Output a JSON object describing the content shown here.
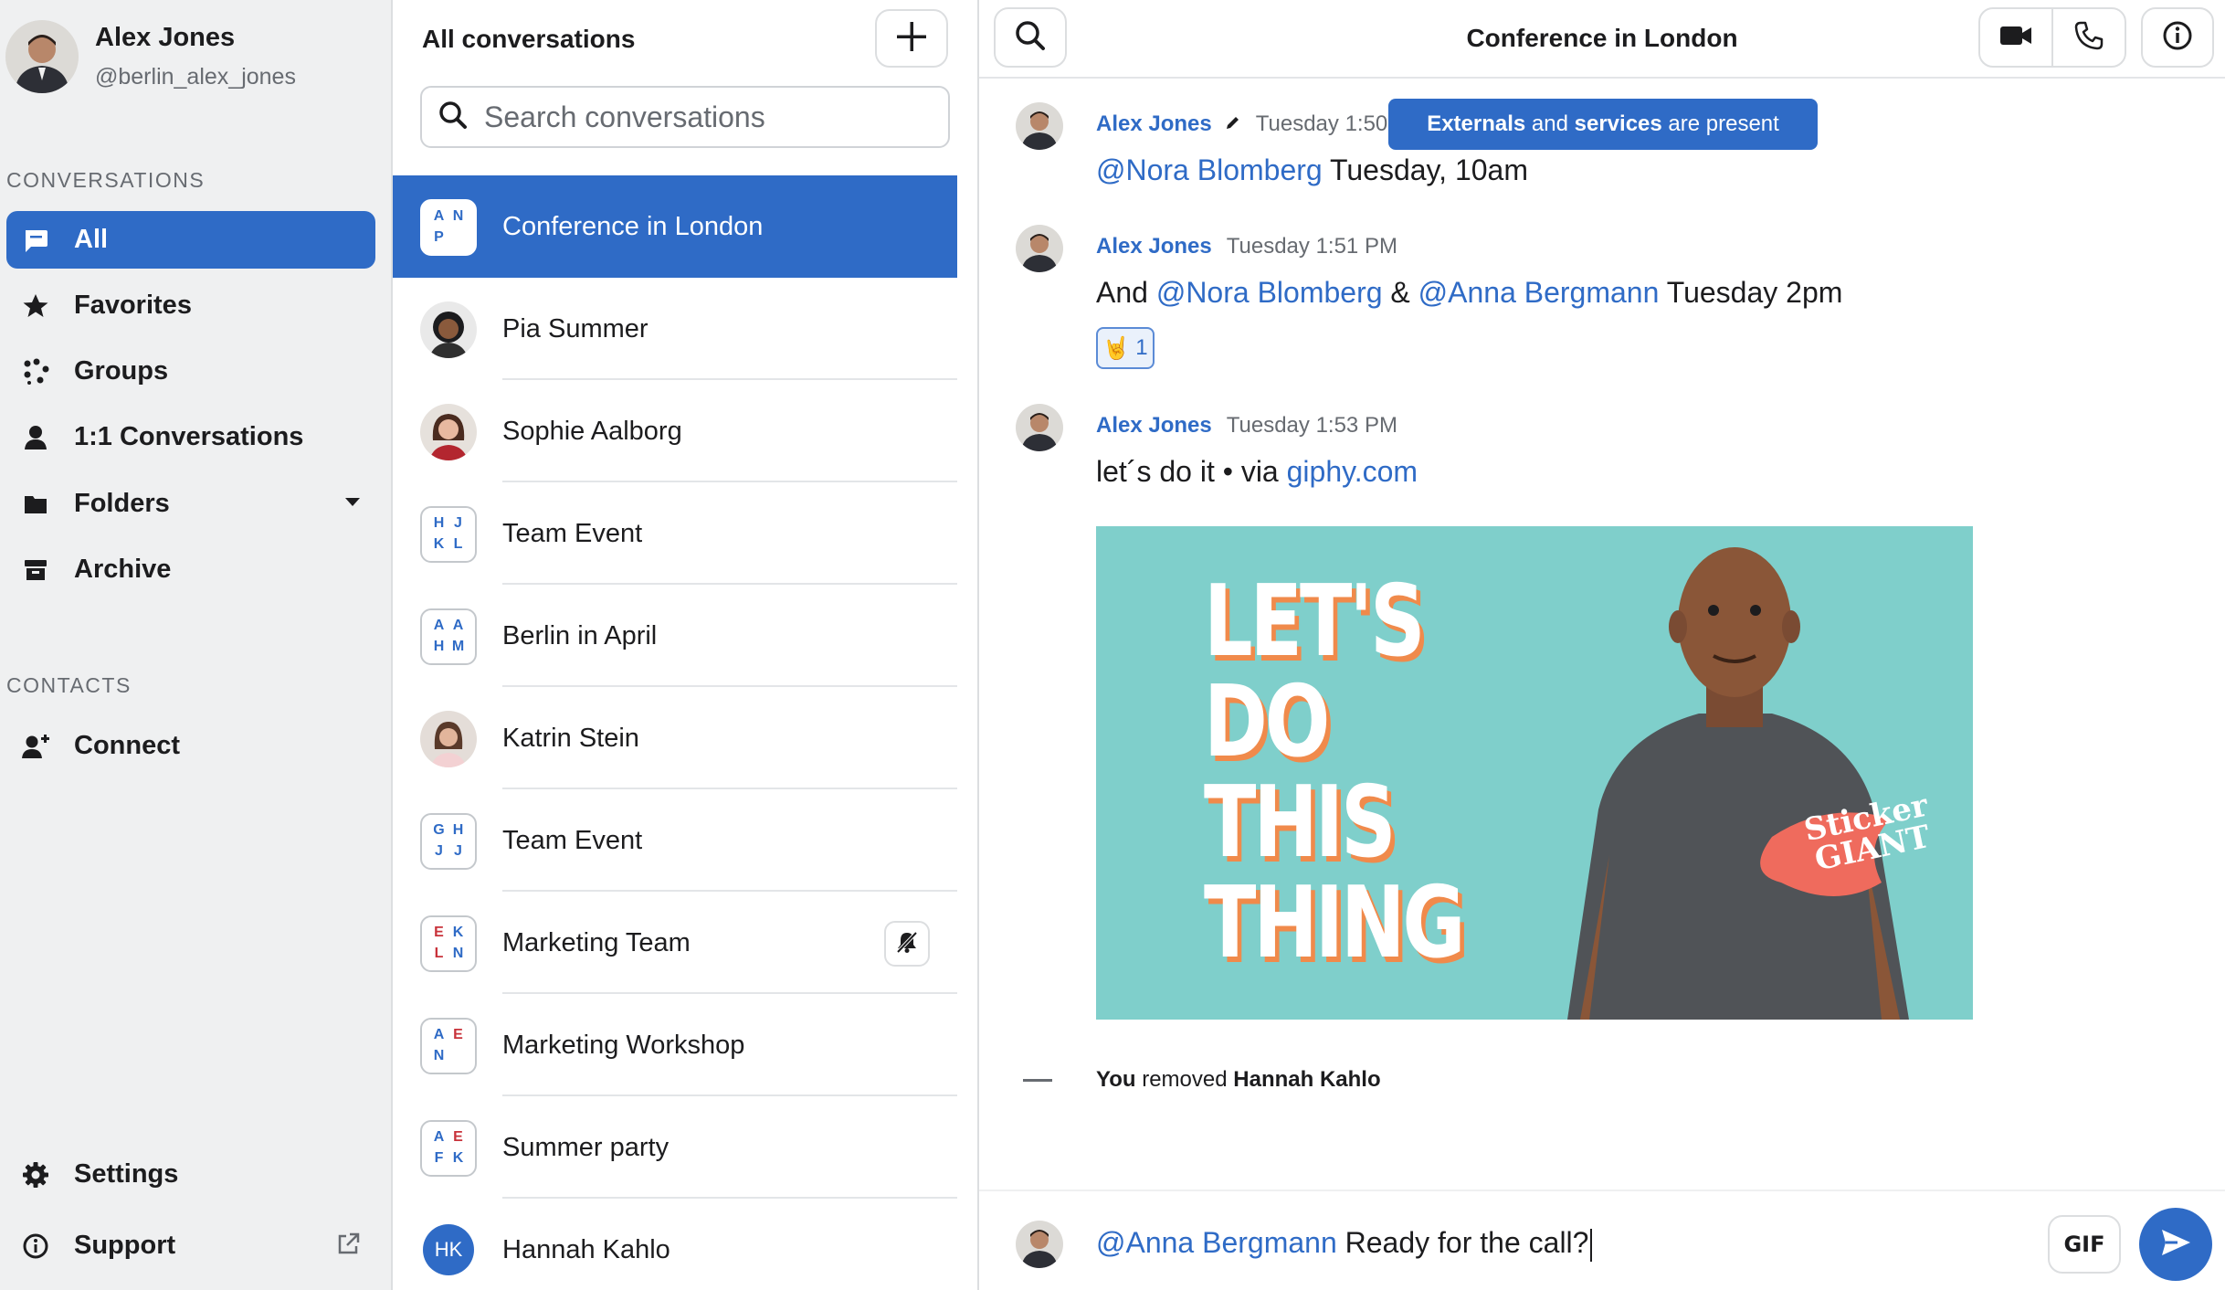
{
  "profile": {
    "name": "Alex Jones",
    "handle": "@berlin_alex_jones"
  },
  "sidebar": {
    "conversations_label": "CONVERSATIONS",
    "contacts_label": "CONTACTS",
    "items": [
      {
        "label": "All",
        "icon": "chat-bubble-icon"
      },
      {
        "label": "Favorites",
        "icon": "star-icon"
      },
      {
        "label": "Groups",
        "icon": "groups-icon"
      },
      {
        "label": "1:1 Conversations",
        "icon": "person-icon"
      },
      {
        "label": "Folders",
        "icon": "folder-icon"
      },
      {
        "label": "Archive",
        "icon": "archive-icon"
      }
    ],
    "connect": {
      "label": "Connect",
      "icon": "add-person-icon"
    },
    "settings": {
      "label": "Settings",
      "icon": "gear-icon"
    },
    "support": {
      "label": "Support",
      "icon": "info-icon"
    }
  },
  "list": {
    "title": "All conversations",
    "search_placeholder": "Search conversations",
    "conversations": [
      {
        "name": "Conference in London",
        "initials": [
          "A",
          "N",
          "P",
          ""
        ]
      },
      {
        "name": "Pia Summer"
      },
      {
        "name": "Sophie Aalborg"
      },
      {
        "name": "Team Event",
        "initials": [
          "H",
          "J",
          "K",
          "L"
        ]
      },
      {
        "name": "Berlin in April",
        "initials": [
          "A",
          "A",
          "H",
          "M"
        ]
      },
      {
        "name": "Katrin Stein"
      },
      {
        "name": "Team Event",
        "initials": [
          "G",
          "H",
          "J",
          "J"
        ]
      },
      {
        "name": "Marketing Team",
        "initials": [
          "E",
          "K",
          "L",
          "N"
        ]
      },
      {
        "name": "Marketing Workshop",
        "initials": [
          "A",
          "E",
          "N",
          ""
        ]
      },
      {
        "name": "Summer party",
        "initials": [
          "A",
          "E",
          "F",
          "K"
        ]
      },
      {
        "name": "Hannah Kahlo",
        "initials_round": "HK"
      }
    ]
  },
  "chat": {
    "title": "Conference in London",
    "toast": {
      "part1": "Externals",
      "part2": " and ",
      "part3": "services",
      "part4": " are present"
    },
    "messages": [
      {
        "author": "Alex Jones",
        "time": "Tuesday 1:50",
        "mention": "@Nora Blomberg",
        "text": " Tuesday, 10am"
      },
      {
        "author": "Alex Jones",
        "time": "Tuesday 1:51 PM",
        "pre": "And ",
        "mention1": "@Nora Blomberg",
        "mid": " & ",
        "mention2": "@Anna Bergmann",
        "text": " Tuesday 2pm",
        "reaction_emoji": "🤘",
        "reaction_count": "1"
      },
      {
        "author": "Alex Jones",
        "time": "Tuesday 1:53 PM",
        "text": "let´s do it • via ",
        "link": "giphy.com"
      }
    ],
    "gif_lines": [
      "LET'S",
      "DO",
      "THIS",
      "THING"
    ],
    "gif_shirt_text": [
      "Sticker",
      "GIANT"
    ],
    "system": {
      "actor": "You",
      "action": " removed ",
      "target": "Hannah Kahlo"
    },
    "composer": {
      "mention": "@Anna Bergmann",
      "text": " Ready for the call?"
    },
    "gif_button": "GIF"
  }
}
